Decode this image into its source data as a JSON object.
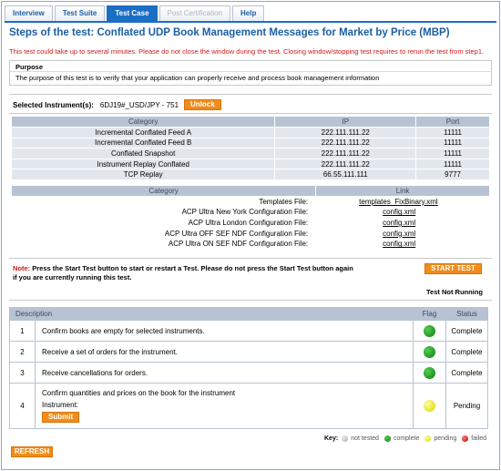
{
  "tabs": [
    {
      "label": "Interview",
      "state": "normal"
    },
    {
      "label": "Test Suite",
      "state": "normal"
    },
    {
      "label": "Test Case",
      "state": "active"
    },
    {
      "label": "Post Certification",
      "state": "disabled"
    },
    {
      "label": "Help",
      "state": "normal"
    }
  ],
  "title": "Steps of the test: Conflated UDP Book Management Messages for Market by Price (MBP)",
  "warning": "This test could take up to several minutes. Please do not close the window during the test. Closing window/stopping test requires to rerun the test from step1.",
  "purpose": {
    "heading": "Purpose",
    "text": "The purpose of this test is to verify that your application can properly receive and process book management information"
  },
  "instrument": {
    "label": "Selected Instrument(s):",
    "value": "6DJ19#_USD/JPY - 751",
    "unlock_label": "Unlock"
  },
  "feeds": {
    "headers": [
      "Category",
      "IP",
      "Port"
    ],
    "rows": [
      [
        "Incremental Conflated Feed A",
        "222.111.111.22",
        "11111"
      ],
      [
        "Incremental Conflated Feed B",
        "222.111.111.22",
        "11111"
      ],
      [
        "Conflated Snapshot",
        "222.111.111.22",
        "11111"
      ],
      [
        "Instrument Replay Conflated",
        "222.111.111.22",
        "11111"
      ],
      [
        "TCP Replay",
        "66.55.111.111",
        "9777"
      ]
    ]
  },
  "links": {
    "headers": [
      "Category",
      "Link"
    ],
    "rows": [
      [
        "Templates File:",
        "templates_FixBinary.xml"
      ],
      [
        "ACP Ultra New York Configuration File:",
        "config.xml"
      ],
      [
        "ACP Ultra London Configuration File:",
        "config.xml"
      ],
      [
        "ACP Ultra OFF SEF NDF Configuration File:",
        "config.xml"
      ],
      [
        "ACP Ultra ON SEF NDF Configuration File:",
        "config.xml"
      ]
    ]
  },
  "note": {
    "label": "Note:",
    "text": "Press the Start Test button to start or restart a Test. Please do not press the Start Test button again if you are currently running this test."
  },
  "start_label": "START TEST",
  "test_status": "Test Not Running",
  "steps": {
    "headers": {
      "description": "Description",
      "flag": "Flag",
      "status": "Status"
    },
    "rows": [
      {
        "num": "1",
        "text": "Confirm books are empty for selected instruments.",
        "flag": "green",
        "status": "Complete"
      },
      {
        "num": "2",
        "text": "Receive a set of orders for the instrument.",
        "flag": "green",
        "status": "Complete"
      },
      {
        "num": "3",
        "text": "Receive cancellations for orders.",
        "flag": "green",
        "status": "Complete"
      },
      {
        "num": "4",
        "text": "Confirm quantities and prices on the book for the instrument",
        "sub_label": "Instrument:",
        "submit_label": "Submit",
        "flag": "yellow",
        "status": "Pending"
      }
    ]
  },
  "key": {
    "label": "Key:",
    "items": [
      {
        "color": "grey",
        "label": "not tested"
      },
      {
        "color": "green",
        "label": "complete"
      },
      {
        "color": "yellow",
        "label": "pending"
      },
      {
        "color": "red",
        "label": "failed"
      }
    ]
  },
  "refresh_label": "REFRESH"
}
